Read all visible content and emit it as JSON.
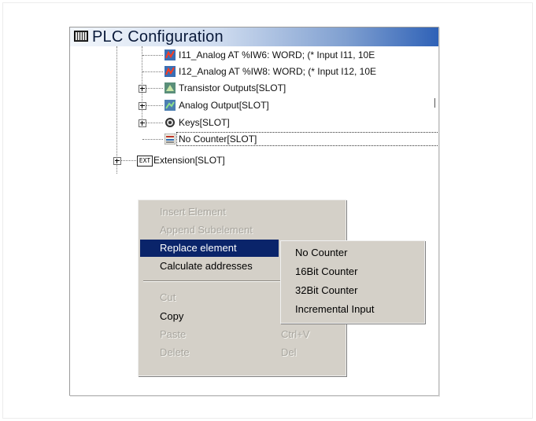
{
  "window": {
    "title": "PLC Configuration"
  },
  "tree": {
    "rows": [
      {
        "label": "I11_Analog AT %IW6: WORD; (* Input I11, 10E"
      },
      {
        "label": "I12_Analog AT %IW8: WORD; (* Input I12, 10E"
      },
      {
        "label": "Transistor Outputs[SLOT]"
      },
      {
        "label": "Analog Output[SLOT]"
      },
      {
        "label": "Keys[SLOT]"
      },
      {
        "label": "No Counter[SLOT]"
      },
      {
        "label": "Extension[SLOT]",
        "icon_text": "EXT"
      }
    ]
  },
  "context_menu": {
    "items": [
      {
        "label": "Insert Element",
        "enabled": false
      },
      {
        "label": "Append Subelement",
        "enabled": false
      },
      {
        "label": "Replace element",
        "enabled": true,
        "highlighted": true
      },
      {
        "label": "Calculate addresses",
        "enabled": true
      },
      {
        "label": "Cut",
        "enabled": false
      },
      {
        "label": "Copy",
        "enabled": true
      },
      {
        "label": "Paste",
        "shortcut": "Ctrl+V",
        "enabled": false
      },
      {
        "label": "Delete",
        "shortcut": "Del",
        "enabled": false
      }
    ]
  },
  "submenu": {
    "items": [
      {
        "label": "No Counter"
      },
      {
        "label": "16Bit Counter"
      },
      {
        "label": "32Bit Counter"
      },
      {
        "label": "Incremental Input"
      }
    ]
  },
  "colors": {
    "highlight": "#0a246a",
    "menu_bg": "#d4d0c8",
    "title_end": "#2f62b7"
  }
}
